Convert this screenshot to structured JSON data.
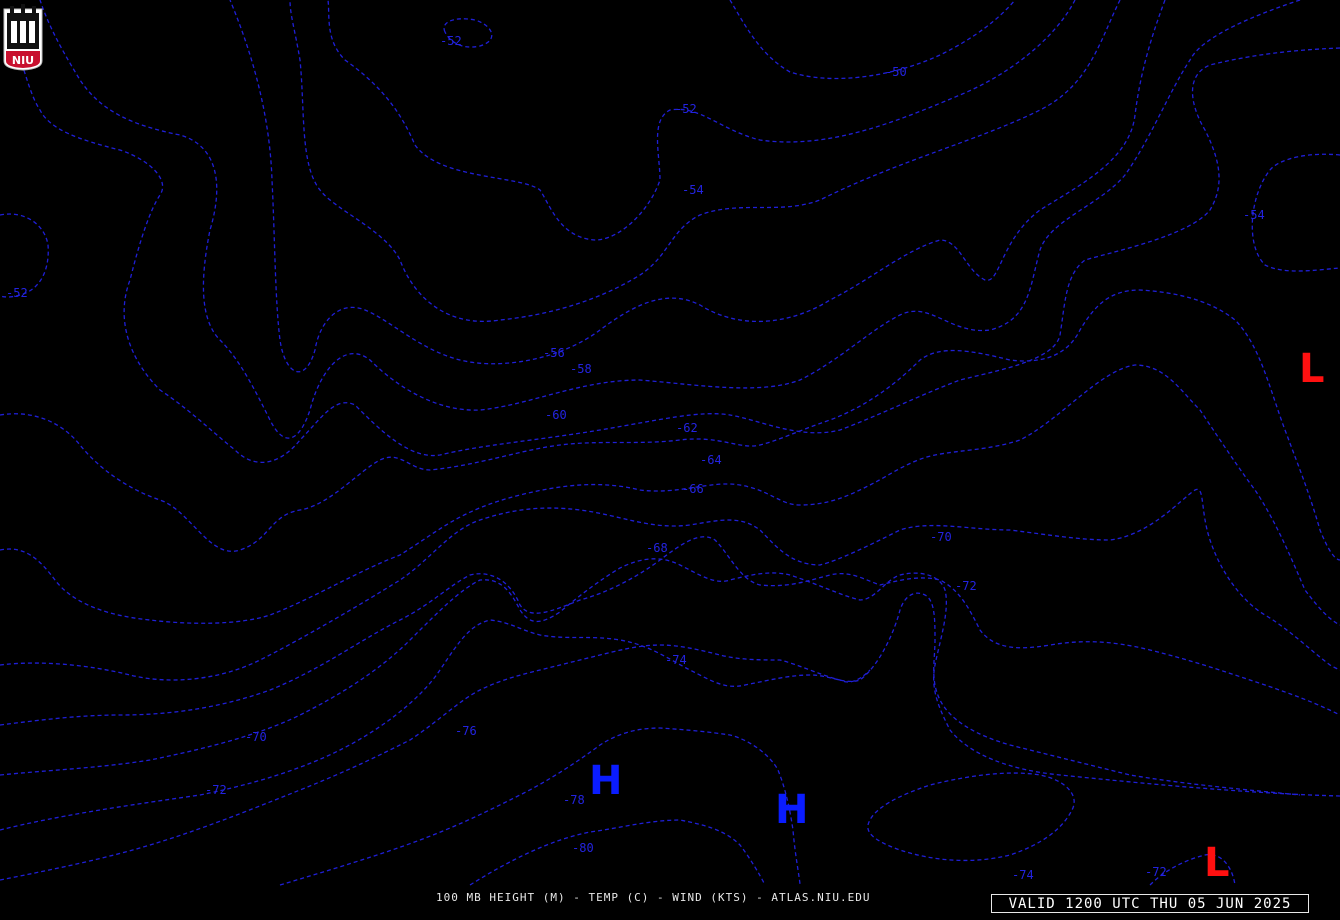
{
  "logo": {
    "text": "NIU",
    "color": "#c8102e"
  },
  "caption": "100 MB HEIGHT (M) - TEMP (C) - WIND (KTS) - ATLAS.NIU.EDU",
  "valid_time": "VALID 1200 UTC THU 05 JUN 2025",
  "colors": {
    "background": "#000000",
    "contour": "#1f1fd6",
    "high": "#0a1cff",
    "low": "#ff1010"
  },
  "contour_labels": [
    "-52",
    "-50",
    "-52",
    "-54",
    "-54",
    "-52",
    "-56",
    "-58",
    "-60",
    "-62",
    "-64",
    "-66",
    "-68",
    "-70",
    "-72",
    "-74",
    "-76",
    "-78",
    "-80",
    "-70",
    "-72",
    "-74",
    "-72"
  ],
  "pressure_centers": [
    "H",
    "H",
    "L",
    "L"
  ]
}
